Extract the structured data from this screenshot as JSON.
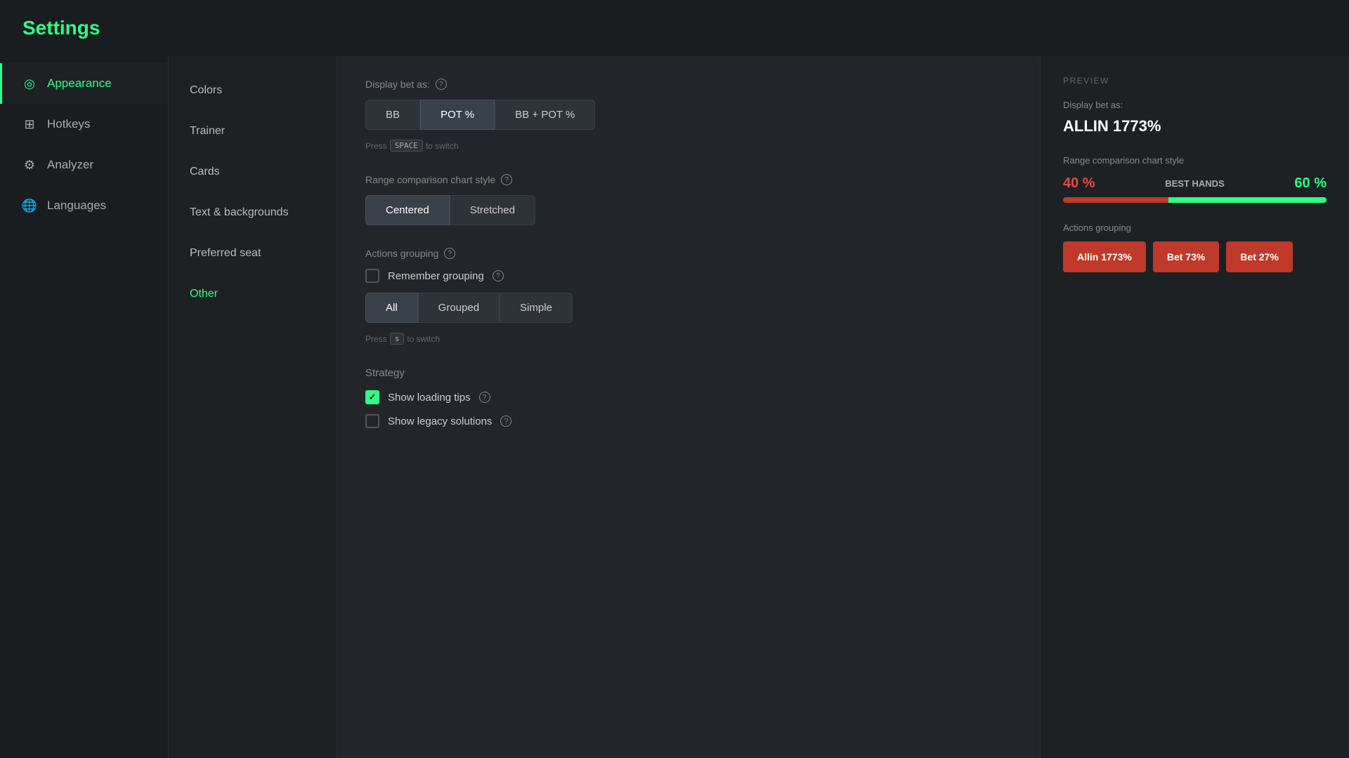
{
  "header": {
    "title": "Settings"
  },
  "sidebar_nav": {
    "items": [
      {
        "id": "appearance",
        "label": "Appearance",
        "icon": "◎",
        "active": true
      },
      {
        "id": "hotkeys",
        "label": "Hotkeys",
        "icon": "⊞",
        "active": false
      },
      {
        "id": "analyzer",
        "label": "Analyzer",
        "icon": "⚙",
        "active": false
      },
      {
        "id": "languages",
        "label": "Languages",
        "icon": "🌐",
        "active": false
      }
    ]
  },
  "sidebar_sub": {
    "items": [
      {
        "id": "colors",
        "label": "Colors",
        "active": false
      },
      {
        "id": "trainer",
        "label": "Trainer",
        "active": false
      },
      {
        "id": "cards",
        "label": "Cards",
        "active": false
      },
      {
        "id": "text-backgrounds",
        "label": "Text & backgrounds",
        "active": false
      },
      {
        "id": "preferred-seat",
        "label": "Preferred seat",
        "active": false
      },
      {
        "id": "other",
        "label": "Other",
        "active": true
      }
    ]
  },
  "content": {
    "display_bet": {
      "label": "Display bet as:",
      "options": [
        "BB",
        "POT %",
        "BB + POT %"
      ],
      "active": "POT %"
    },
    "press_space_hint": "Press",
    "press_space_key": "SPACE",
    "press_space_suffix": "to switch",
    "range_chart": {
      "label": "Range comparison chart style",
      "options": [
        "Centered",
        "Stretched"
      ],
      "active": "Centered"
    },
    "actions_grouping": {
      "label": "Actions grouping",
      "remember_label": "Remember grouping",
      "remember_checked": false,
      "options": [
        "All",
        "Grouped",
        "Simple"
      ],
      "active": "All"
    },
    "press_s_hint": "Press",
    "press_s_key": "s",
    "press_s_suffix": "to switch",
    "strategy": {
      "label": "Strategy",
      "show_loading_tips": {
        "label": "Show loading tips",
        "checked": true
      },
      "show_legacy_solutions": {
        "label": "Show legacy solutions",
        "checked": false
      }
    }
  },
  "preview": {
    "title": "PREVIEW",
    "display_bet_label": "Display bet as:",
    "display_bet_value": "ALLIN 1773%",
    "chart_label": "Range comparison chart style",
    "chart_left_pct": "40 %",
    "chart_center_label": "BEST HANDS",
    "chart_right_pct": "60 %",
    "chart_left_width": 40,
    "chart_right_width": 60,
    "actions_grouping_label": "Actions grouping",
    "action_buttons": [
      {
        "label": "Allin 1773%"
      },
      {
        "label": "Bet 73%"
      },
      {
        "label": "Bet 27%"
      }
    ]
  }
}
